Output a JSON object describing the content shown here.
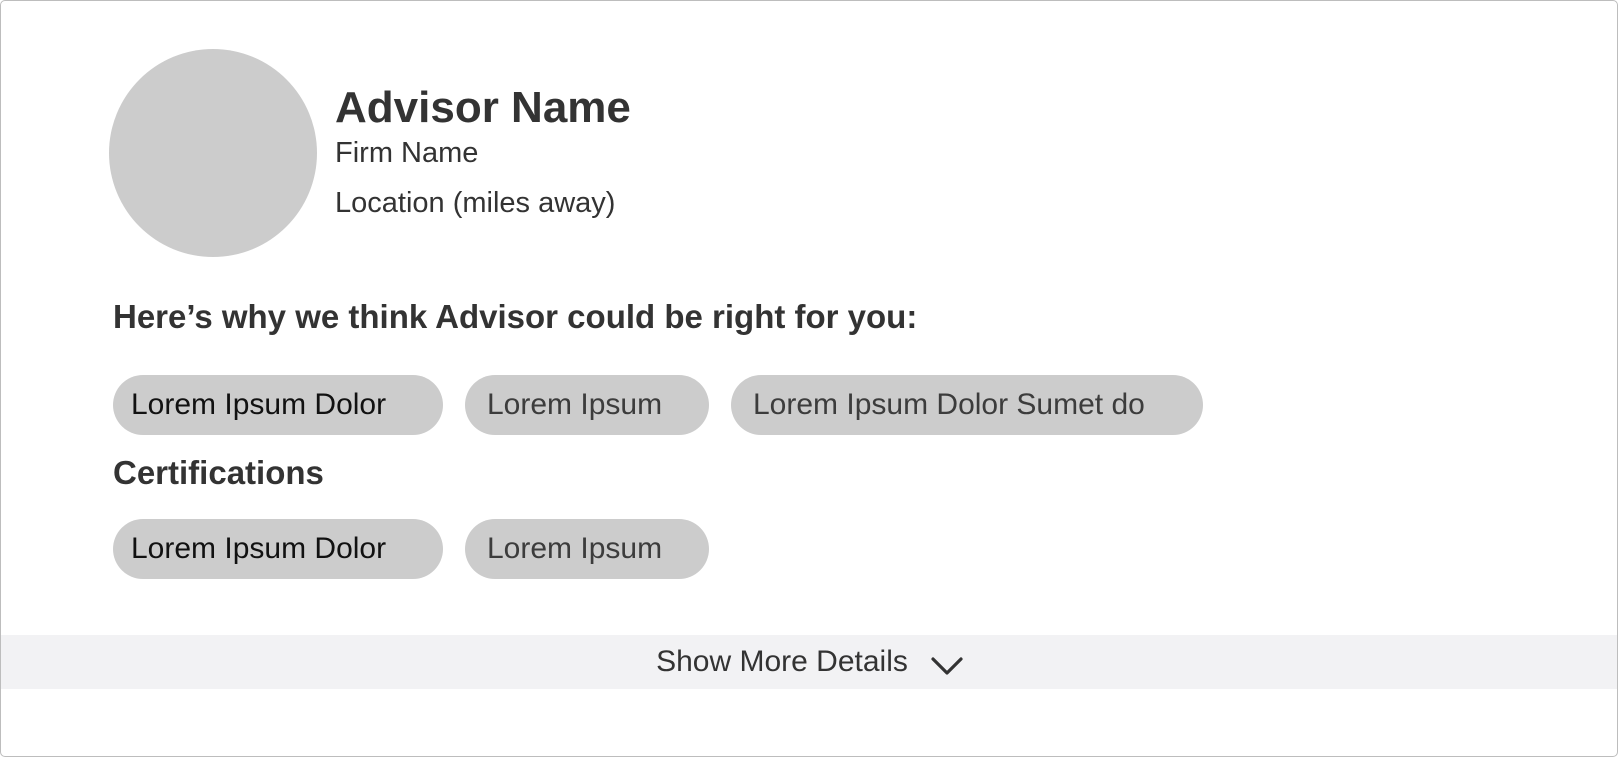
{
  "advisor": {
    "name": "Advisor Name",
    "firm": "Firm Name",
    "location": "Location (miles away)"
  },
  "why_section": {
    "heading": "Here’s why we think Advisor could be right for you:",
    "chips": [
      "Lorem Ipsum Dolor",
      "Lorem Ipsum",
      "Lorem Ipsum Dolor Sumet do"
    ]
  },
  "certifications": {
    "heading": "Certifications",
    "chips": [
      "Lorem Ipsum Dolor",
      "Lorem Ipsum"
    ]
  },
  "show_more": {
    "label": "Show More Details",
    "icon": "chevron-down-icon"
  },
  "colors": {
    "chip_background": "#cccccc",
    "avatar_placeholder": "#cccccc",
    "footer_background": "#f2f2f4",
    "text": "#333333"
  }
}
